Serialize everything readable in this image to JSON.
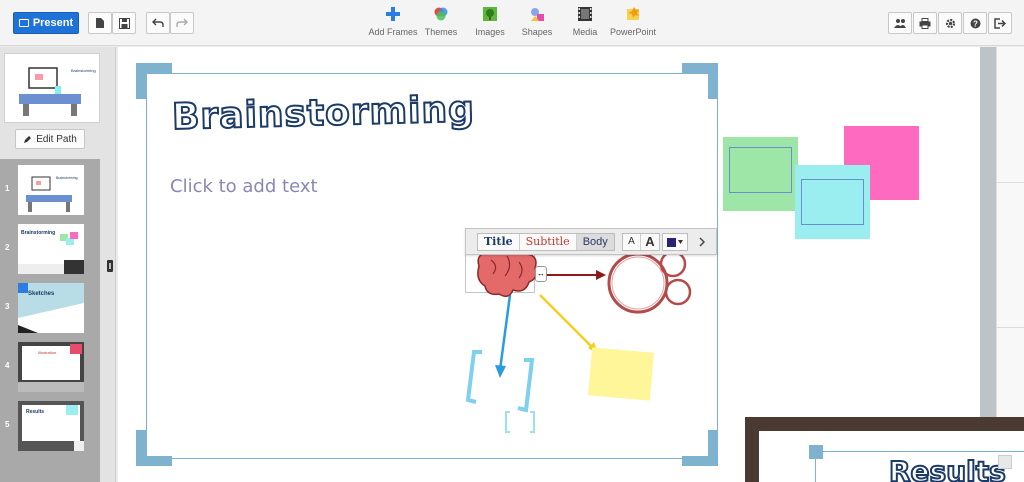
{
  "toolbar": {
    "present_label": "Present",
    "tools": [
      {
        "label": "Add Frames",
        "icon": "add-frames-icon"
      },
      {
        "label": "Themes",
        "icon": "themes-icon"
      },
      {
        "label": "Images",
        "icon": "images-icon"
      },
      {
        "label": "Shapes",
        "icon": "shapes-icon"
      },
      {
        "label": "Media",
        "icon": "media-icon"
      },
      {
        "label": "PowerPoint",
        "icon": "powerpoint-icon"
      }
    ]
  },
  "sidebar": {
    "edit_path_label": "Edit Path",
    "slides": [
      {
        "num": "1"
      },
      {
        "num": "2"
      },
      {
        "num": "3"
      },
      {
        "num": "4"
      },
      {
        "num": "5"
      }
    ]
  },
  "slide": {
    "title": "Brainstorming",
    "placeholder": "Click to add text"
  },
  "format_bar": {
    "title_label": "Title",
    "subtitle_label": "Subtitle",
    "body_label": "Body",
    "small_a": "A",
    "big_a": "A",
    "color": "#2a2274"
  },
  "canvas_text": {
    "results": "Results"
  },
  "colors": {
    "accent": "#1f73d8",
    "frame_border": "#7bb3d4",
    "title_stroke": "#1b3a66",
    "sticky_green": "#9ee6a8",
    "sticky_cyan": "#9aeef0",
    "sticky_pink": "#ff6ac1",
    "sticky_yellow": "#fff69a"
  }
}
